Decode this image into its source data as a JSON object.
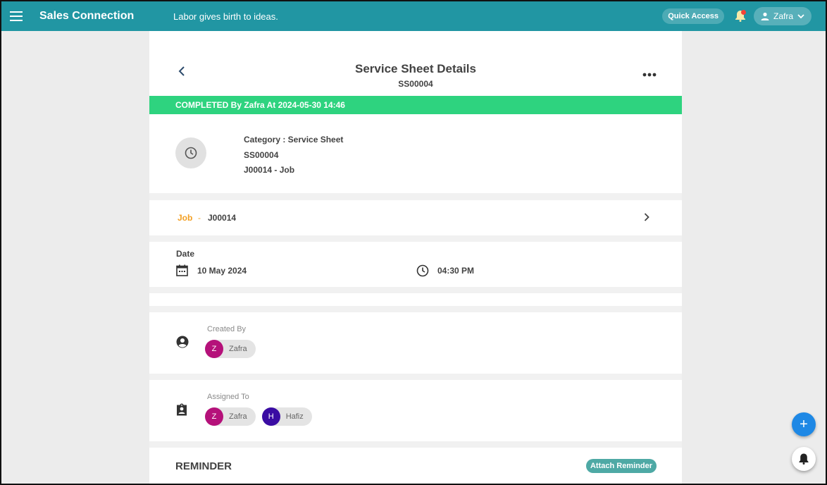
{
  "topbar": {
    "brand": "Sales Connection",
    "tagline": "Labor gives birth to ideas.",
    "quick_access": "Quick Access",
    "user": "Zafra"
  },
  "header": {
    "title": "Service Sheet Details",
    "code": "SS00004"
  },
  "status_banner": "COMPLETED By Zafra At 2024-05-30 14:46",
  "category": {
    "line1": "Category : Service Sheet",
    "line2": "SS00004",
    "line3": "J00014 - Job"
  },
  "job": {
    "label": "Job",
    "dash": "-",
    "id": "J00014"
  },
  "datetime": {
    "label": "Date",
    "date": "10 May 2024",
    "time": "04:30 PM"
  },
  "created_by": {
    "label": "Created By",
    "people": [
      {
        "initial": "Z",
        "name": "Zafra",
        "color": "#b5117a"
      }
    ]
  },
  "assigned_to": {
    "label": "Assigned To",
    "people": [
      {
        "initial": "Z",
        "name": "Zafra",
        "color": "#b5117a"
      },
      {
        "initial": "H",
        "name": "Hafiz",
        "color": "#3a0ca3"
      }
    ]
  },
  "reminder": {
    "title": "REMINDER",
    "attach_label": "Attach Reminder"
  },
  "fab": {
    "add_symbol": "+"
  },
  "colors": {
    "topbar": "#2196a3",
    "status": "#2ed37f",
    "job_accent": "#f3a024",
    "attach": "#4ea9a5",
    "fab": "#1e88e5"
  }
}
